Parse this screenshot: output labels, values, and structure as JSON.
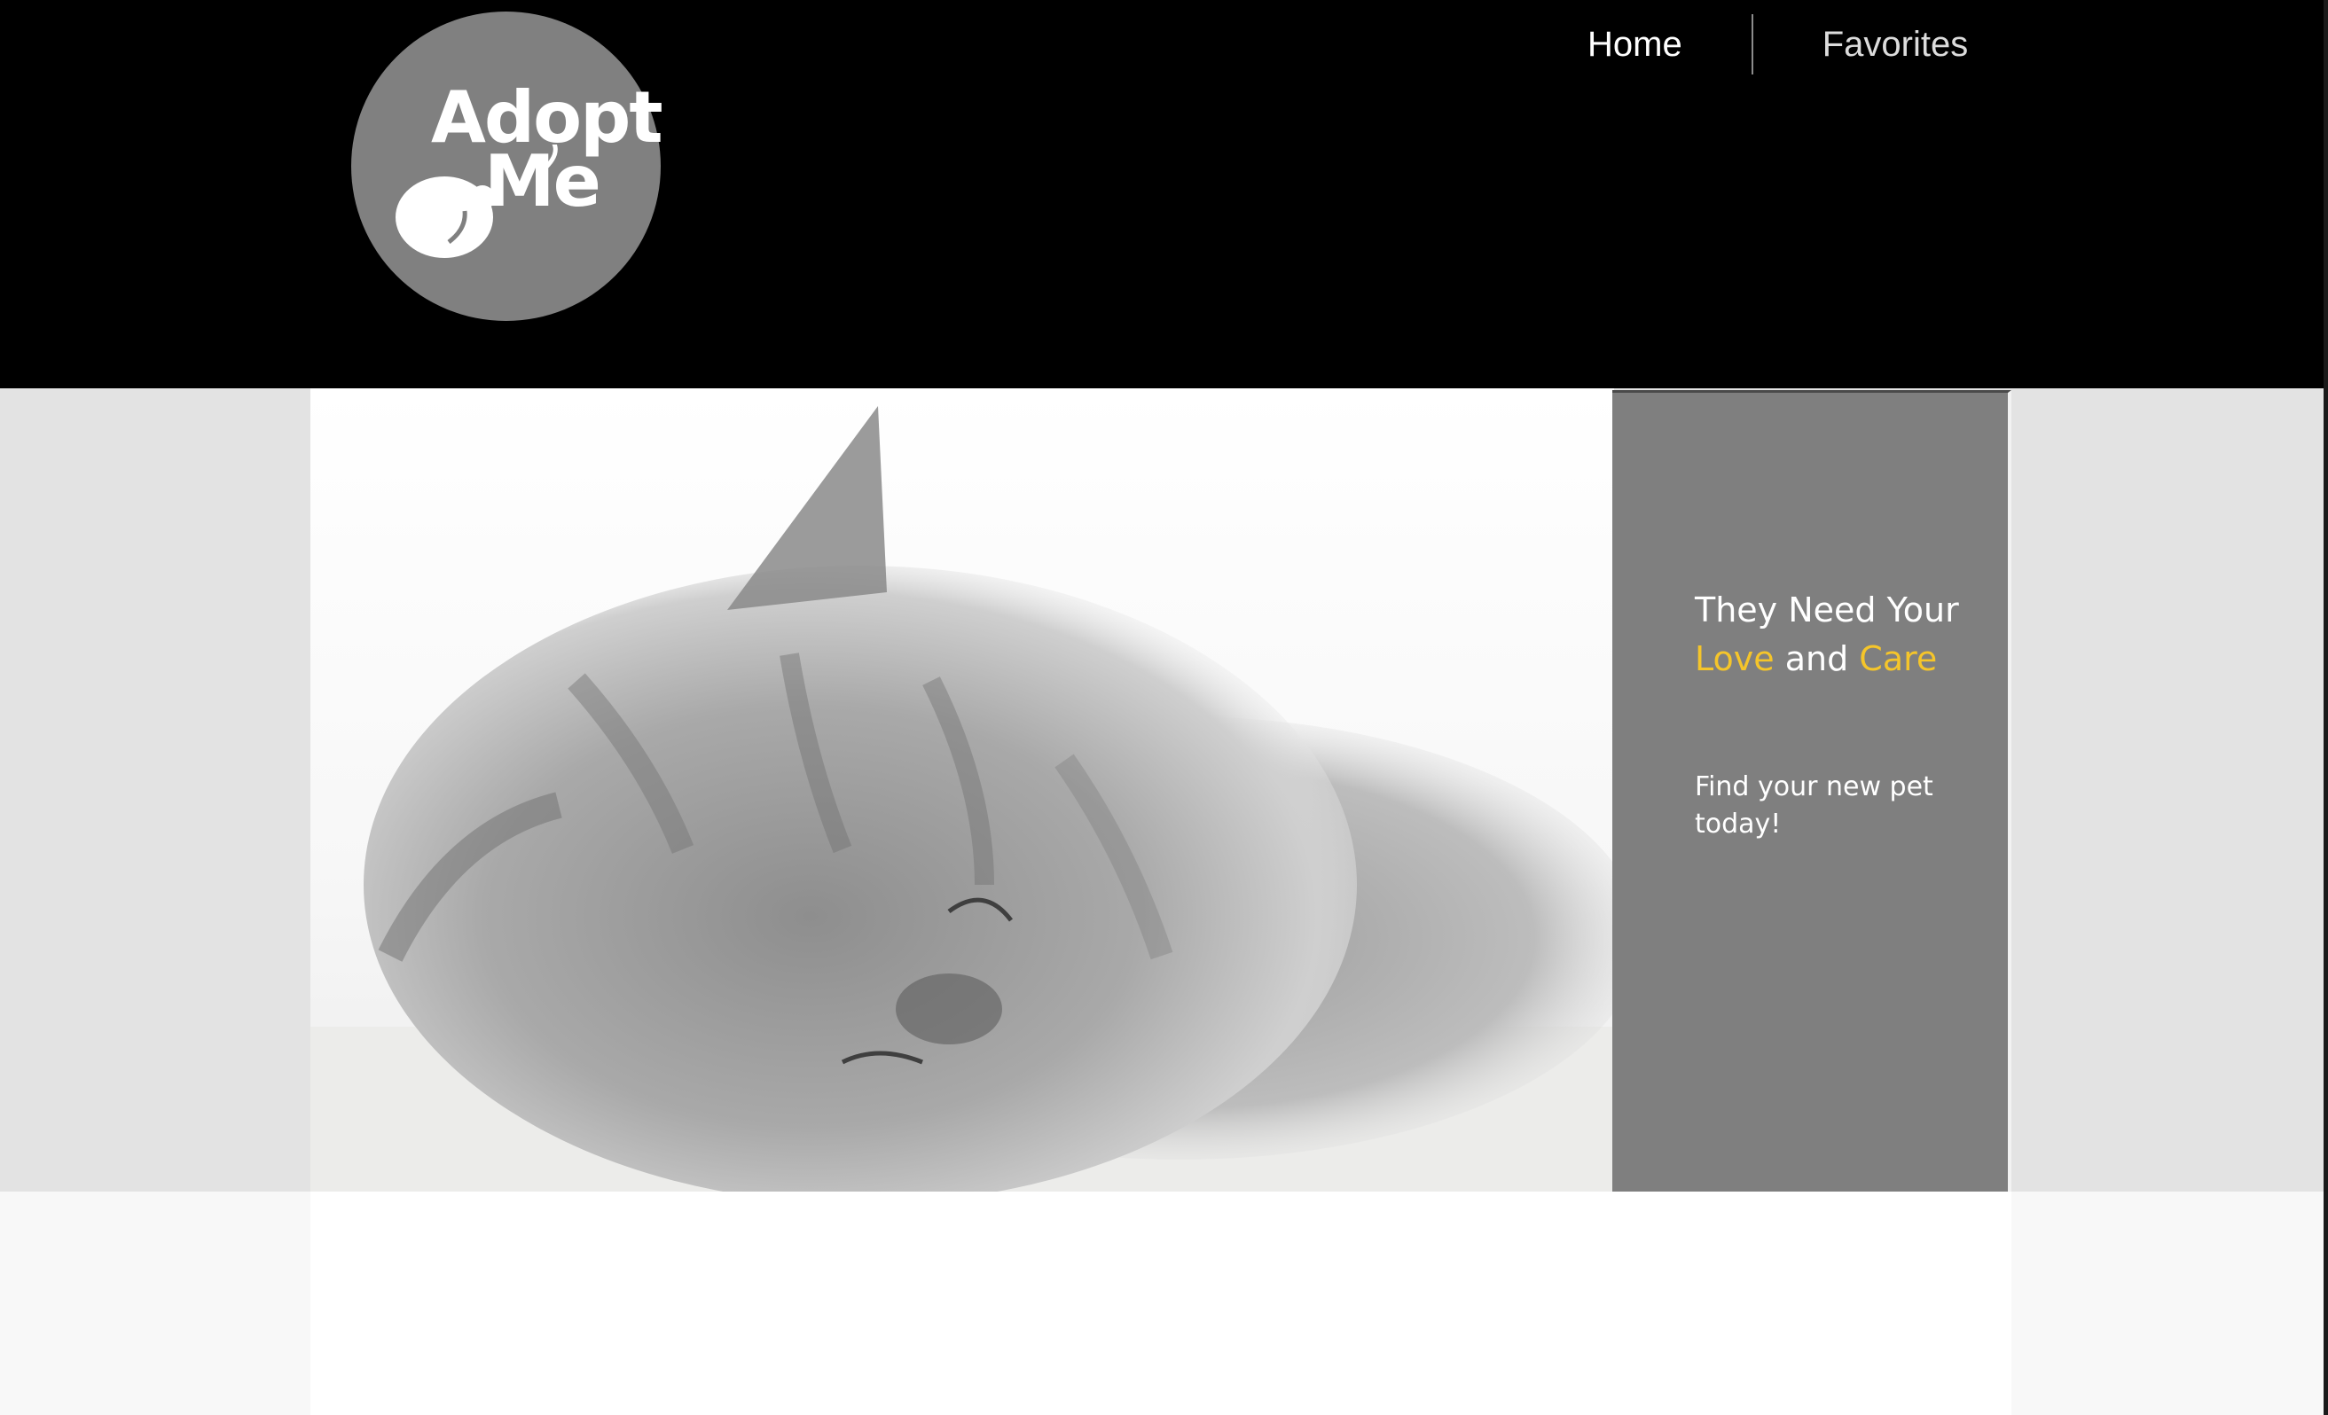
{
  "header": {
    "logo": {
      "line1": "Adopt",
      "line2": "Me"
    },
    "nav": [
      {
        "label": "Home"
      },
      {
        "label": "Favorites"
      }
    ]
  },
  "hero": {
    "image": "sleeping-gray-kitten",
    "heading_part1": "They Need Your ",
    "heading_love": "Love",
    "heading_part2": " and ",
    "heading_care": "Care",
    "subtext": "Find your new pet today!"
  },
  "colors": {
    "accent": "#f5c52a",
    "panel": "#7f7f7f",
    "header": "#000000"
  }
}
